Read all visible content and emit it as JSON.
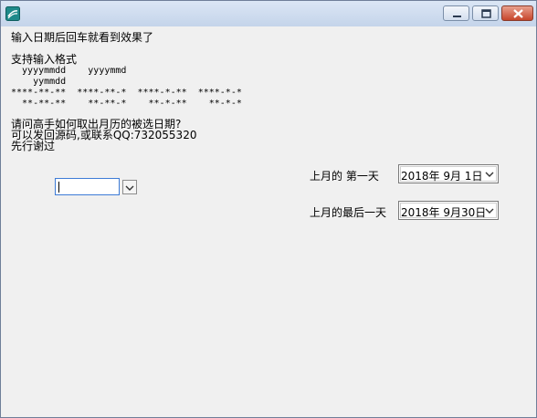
{
  "window": {
    "title": ""
  },
  "content": {
    "instruction": "输入日期后回车就看到效果了",
    "formats_title": "支持输入格式",
    "format_line1": "  yyyymmdd    yyyymmd",
    "format_line2": "    yymmdd",
    "format_line3": "****-**-**  ****-**-*  ****-*-**  ****-*-*",
    "format_line4": "  **-**-**    **-**-*    **-*-**    **-*-*",
    "question": "请问高手如何取出月历的被选日期?",
    "contact": "可以发回源码,或联系QQ:732055320",
    "thanks": "先行谢过"
  },
  "date_combo": {
    "value": ""
  },
  "first_day": {
    "label": "上月的  第一天",
    "value": "2018年 9月 1日"
  },
  "last_day": {
    "label": "上月的最后一天",
    "value": "2018年 9月30日"
  }
}
